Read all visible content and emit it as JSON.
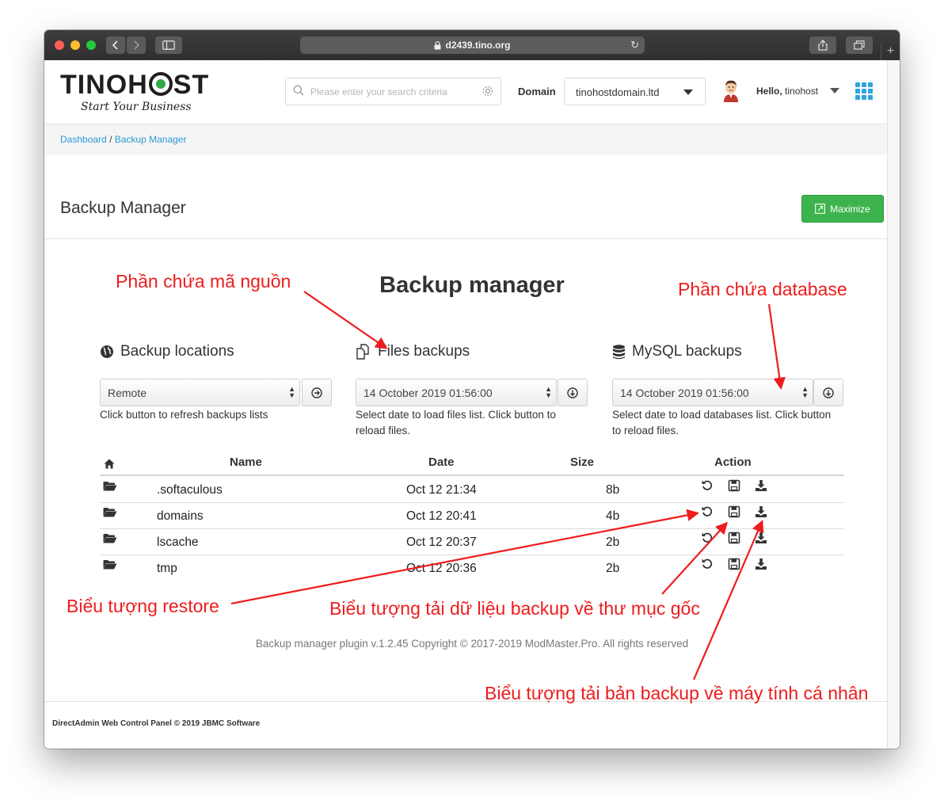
{
  "browser": {
    "url": "d2439.tino.org"
  },
  "header": {
    "logo_text_1": "TINOH",
    "logo_text_2": "ST",
    "logo_tagline": "Start Your Business",
    "search_placeholder": "Please enter your search criteria",
    "domain_label": "Domain",
    "domain_value": "tinohostdomain.ltd",
    "hello_prefix": "Hello,",
    "username": "tinohost"
  },
  "breadcrumb": {
    "dashboard": "Dashboard",
    "separator": "/",
    "current": "Backup Manager"
  },
  "page": {
    "title": "Backup Manager",
    "maximize_label": "Maximize"
  },
  "backup_manager": {
    "title": "Backup manager",
    "locations": {
      "heading": "Backup locations",
      "selected": "Remote",
      "help": "Click button to refresh backups lists"
    },
    "files": {
      "heading": "Files backups",
      "selected": "14 October 2019 01:56:00",
      "help_1": "Select date to load files list. Click button to",
      "help_2": "reload files."
    },
    "mysql": {
      "heading": "MySQL backups",
      "selected": "14 October 2019 01:56:00",
      "help_1": "Select date to load databases list. Click button",
      "help_2": "to reload files."
    },
    "table": {
      "headers": [
        "Name",
        "Date",
        "Size",
        "Action"
      ],
      "rows": [
        {
          "name": ".softaculous",
          "date": "Oct 12 21:34",
          "size": "8b"
        },
        {
          "name": "domains",
          "date": "Oct 12 20:41",
          "size": "4b"
        },
        {
          "name": "lscache",
          "date": "Oct 12 20:37",
          "size": "2b"
        },
        {
          "name": "tmp",
          "date": "Oct 12 20:36",
          "size": "2b"
        }
      ]
    },
    "plugin_note": "Backup manager plugin v.1.2.45 Copyright © 2017-2019 ModMaster.Pro. All rights reserved"
  },
  "footer": {
    "copyright": "DirectAdmin Web Control Panel © 2019 JBMC Software"
  },
  "annotations": {
    "source_code": "Phần chứa mã nguồn",
    "database": "Phần chứa database",
    "restore": "Biểu tượng restore",
    "download_root": "Biểu tượng tải dữ liệu backup về thư mục gốc",
    "download_pc": "Biểu tượng tải bản backup về máy tính cá nhân"
  },
  "colors": {
    "annotation": "#ee1c1c",
    "link": "#2a9ad5",
    "maximize_bg": "#3db34d",
    "grid_icon": "#2aa6e0"
  }
}
